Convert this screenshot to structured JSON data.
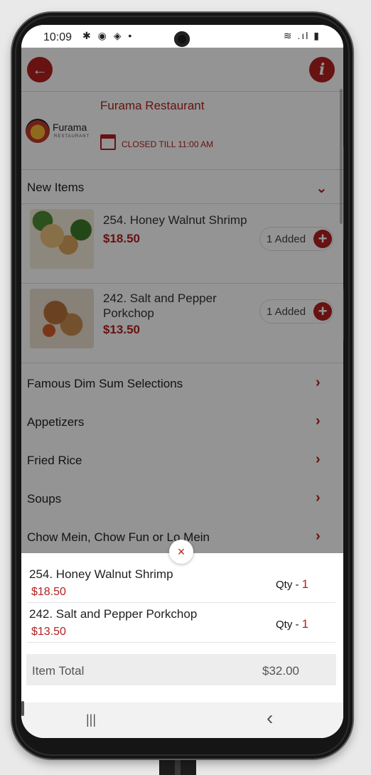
{
  "status_bar": {
    "time": "10:09",
    "left_icons": "✱ ◉ ◈ •",
    "right_icons": "≋ .ıl ▮"
  },
  "restaurant": {
    "name": "Furama Restaurant",
    "logo_text": "Furama",
    "logo_sub": "RESTAURANT",
    "status": "CLOSED TILL 11:00 AM"
  },
  "sections": {
    "new_items": {
      "label": "New Items",
      "items": [
        {
          "name": "254. Honey Walnut Shrimp",
          "price": "$18.50",
          "added": "1 Added"
        },
        {
          "name": "242. Salt and Pepper Porkchop",
          "price": "$13.50",
          "added": "1 Added"
        }
      ]
    },
    "categories": [
      "Famous Dim Sum Selections",
      "Appetizers",
      "Fried Rice",
      "Soups",
      "Chow Mein, Chow Fun or Lo Mein"
    ]
  },
  "cart": {
    "items": [
      {
        "name": "254. Honey Walnut Shrimp",
        "price": "$18.50",
        "qty_label": "Qty - ",
        "qty": "1"
      },
      {
        "name": "242. Salt and Pepper Porkchop",
        "price": "$13.50",
        "qty_label": "Qty - ",
        "qty": "1"
      }
    ],
    "total_label": "Item Total",
    "total_value": "$32.00"
  },
  "icons": {
    "back": "←",
    "info": "i",
    "plus": "+",
    "chevron_right": "›",
    "chevron_down": "⌄",
    "close": "×",
    "nav_recents": "|||",
    "nav_back": "‹"
  },
  "colors": {
    "accent": "#b32020"
  }
}
